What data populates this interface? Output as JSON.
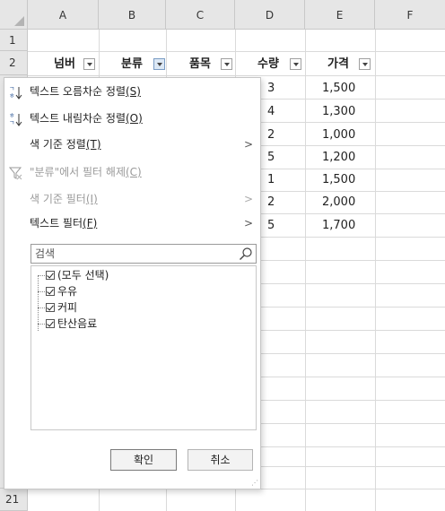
{
  "columns": [
    "A",
    "B",
    "C",
    "D",
    "E",
    "F"
  ],
  "rows": {
    "r1": "1",
    "r2": "2",
    "r21": "21"
  },
  "headers": {
    "a": "넘버",
    "b": "분류",
    "c": "품목",
    "d": "수량",
    "e": "가격"
  },
  "visible_values": [
    {
      "d": "3",
      "e": "1,500"
    },
    {
      "d": "4",
      "e": "1,300"
    },
    {
      "d": "2",
      "e": "1,000"
    },
    {
      "d": "5",
      "e": "1,200"
    },
    {
      "d": "1",
      "e": "1,500"
    },
    {
      "d": "2",
      "e": "2,000"
    },
    {
      "d": "5",
      "e": "1,700"
    }
  ],
  "menu": {
    "sort_asc": "텍스트 오름차순 정렬",
    "sort_asc_key": "(S)",
    "sort_desc": "텍스트 내림차순 정렬",
    "sort_desc_key": "(O)",
    "sort_color": "색 기준 정렬",
    "sort_color_key": "(T)",
    "clear_filter": "\"분류\"에서 필터 해제",
    "clear_filter_key": "(C)",
    "filter_color": "색 기준 필터",
    "filter_color_key": "(I)",
    "text_filter": "텍스트 필터",
    "text_filter_key": "(F)",
    "search_placeholder": "검색",
    "items": [
      "(모두 선택)",
      "우유",
      "커피",
      "탄산음료"
    ],
    "ok": "확인",
    "cancel": "취소",
    "arrow": ">"
  }
}
